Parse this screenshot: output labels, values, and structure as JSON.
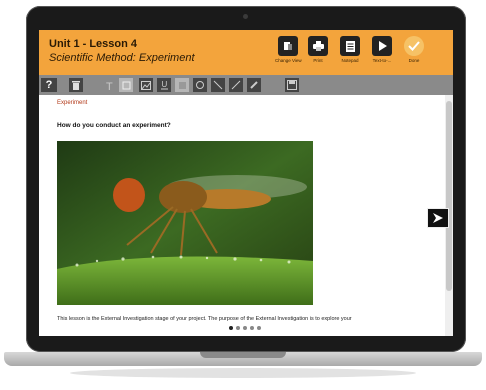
{
  "header": {
    "title": "Unit 1 - Lesson 4",
    "subtitle": "Scientific Method: Experiment",
    "color": "#f3a43c",
    "buttons": [
      {
        "label": "Change View",
        "icon": "change-view-icon"
      },
      {
        "label": "Print",
        "icon": "print-icon"
      },
      {
        "label": "Notepad",
        "icon": "notepad-icon"
      },
      {
        "label": "Text-to-...",
        "icon": "play-icon"
      },
      {
        "label": "Done",
        "icon": "checkmark-icon"
      }
    ]
  },
  "toolbar": {
    "help_label": "?",
    "tools": [
      "trash-icon",
      "text-tool-icon",
      "box-tool-icon",
      "image-tool-icon",
      "underline-icon",
      "highlight-icon",
      "circle-icon",
      "line-icon",
      "slash-icon",
      "pen-icon",
      "save-icon"
    ]
  },
  "content": {
    "breadcrumb": "Experiment",
    "question": "How do you conduct an experiment?",
    "image_subject": "hoverfly-on-leaf-photo",
    "paragraph": "This lesson is the External Investigation stage of your project. The purpose of the External Investigation is to explore your",
    "pager": {
      "total": 5,
      "current": 1
    }
  }
}
